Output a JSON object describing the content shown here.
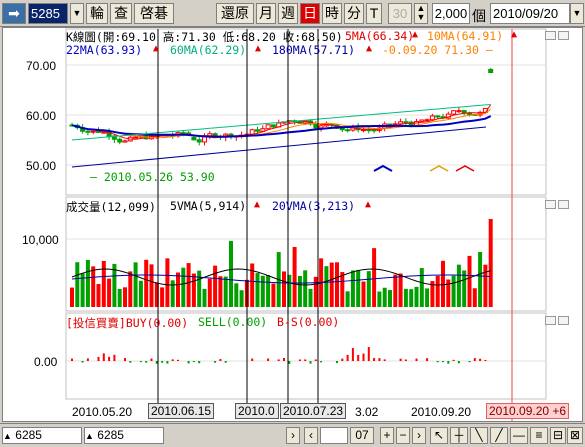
{
  "toolbar": {
    "stock_code": "5285",
    "buttons": [
      "輪",
      "查",
      "啓碁",
      "還原",
      "月",
      "週",
      "日",
      "時",
      "分",
      "T"
    ],
    "quantity_left": "30",
    "quantity": "2,000",
    "quantity_unit": "個",
    "date": "2010/09/20"
  },
  "price_panel": {
    "header_k": "K線圖(開:69.10 高:71.30 低:68.20 收:68.50)",
    "ma5": "5MA(66.34)",
    "ma10": "10MA(64.91)",
    "ma22": "22MA(63.93)",
    "ma60": "60MA(62.29)",
    "ma180": "180MA(57.71)",
    "change": "-0.09.20  71.30 —",
    "low_note": "— 2010.05.26  53.90",
    "y_labels": [
      "70.00",
      "60.00",
      "50.00"
    ]
  },
  "volume_panel": {
    "header": "成交量(12,099)",
    "vma5": "5VMA(5,914)",
    "vma20": "20VMA(3,213)",
    "y_labels": [
      "10,000"
    ]
  },
  "inst_panel": {
    "header": "[投信買賣]BUY(0.00)",
    "sell": "SELL(0.00)",
    "bs": "B-S(0.00)",
    "y_labels": [
      "0.00"
    ]
  },
  "x_axis": {
    "labels": [
      "2010.05.20",
      "2010.06.15",
      "2010.0",
      "2010.07.23",
      "3.02",
      "2010.09.20"
    ],
    "cursor_label": "2010.09.20 +6"
  },
  "bottom": {
    "tab1": "6285",
    "tab2": "6285",
    "zoom": "07"
  },
  "colors": {
    "up": "#ff0000",
    "down": "#00a000",
    "ma5": "#ff0000",
    "ma10": "#ff8000",
    "ma22": "#0000c0",
    "ma60": "#00c080",
    "ma180": "#0000a0"
  }
}
